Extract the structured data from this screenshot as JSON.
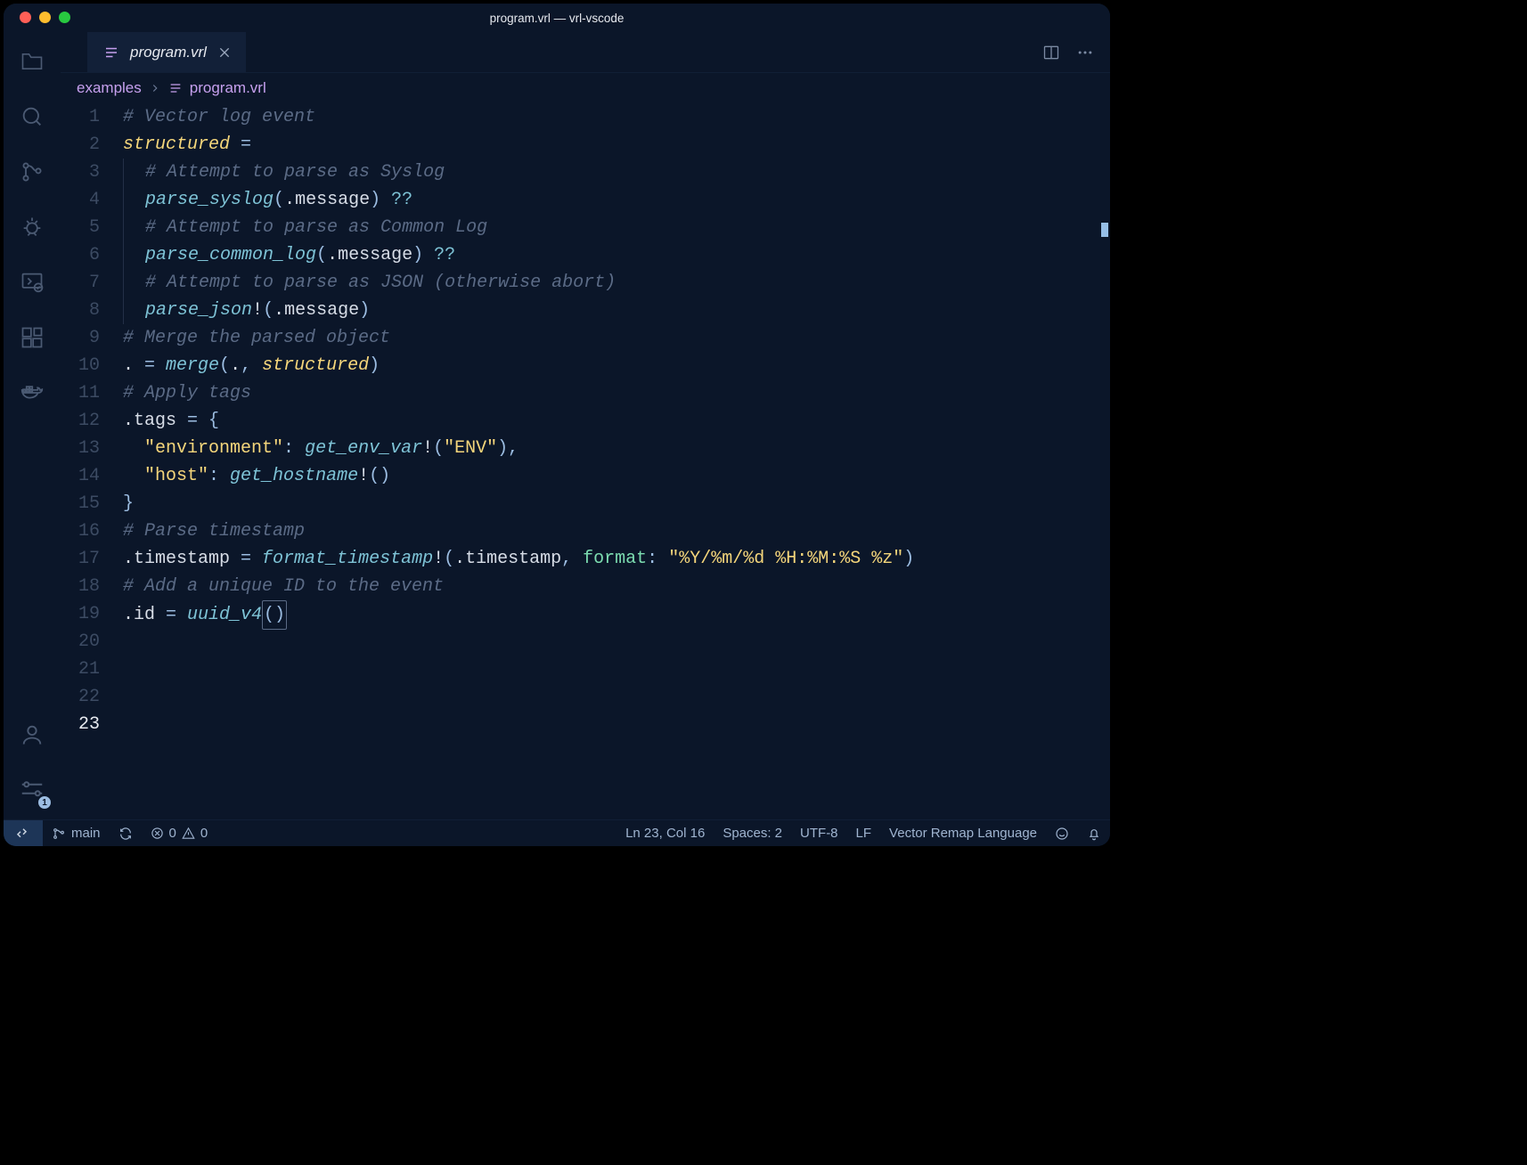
{
  "window": {
    "title": "program.vrl — vrl-vscode"
  },
  "tab": {
    "label": "program.vrl"
  },
  "breadcrumbs": {
    "folder": "examples",
    "file": "program.vrl"
  },
  "settings_badge": "1",
  "statusbar": {
    "branch": "main",
    "errors": "0",
    "warnings": "0",
    "position": "Ln 23, Col 16",
    "spaces": "Spaces: 2",
    "encoding": "UTF-8",
    "eol": "LF",
    "language": "Vector Remap Language"
  },
  "code": {
    "lines": [
      {
        "n": 1,
        "t": [
          [
            "comment",
            "# Vector log event"
          ]
        ]
      },
      {
        "n": 2,
        "t": [
          [
            "var",
            "structured"
          ],
          [
            "plain",
            " "
          ],
          [
            "op",
            "="
          ]
        ]
      },
      {
        "n": 3,
        "t": [
          [
            "indentguide",
            ""
          ],
          [
            "plain",
            "  "
          ],
          [
            "comment",
            "# Attempt to parse as Syslog"
          ]
        ]
      },
      {
        "n": 4,
        "t": [
          [
            "indentguide",
            ""
          ],
          [
            "plain",
            "  "
          ],
          [
            "fn",
            "parse_syslog"
          ],
          [
            "punc",
            "("
          ],
          [
            "field",
            ".message"
          ],
          [
            "punc",
            ")"
          ],
          [
            "plain",
            " "
          ],
          [
            "qq",
            "??"
          ]
        ]
      },
      {
        "n": 5,
        "t": [
          [
            "indentguide",
            ""
          ],
          [
            "plain",
            "  "
          ],
          [
            "comment",
            "# Attempt to parse as Common Log"
          ]
        ]
      },
      {
        "n": 6,
        "t": [
          [
            "indentguide",
            ""
          ],
          [
            "plain",
            "  "
          ],
          [
            "fn",
            "parse_common_log"
          ],
          [
            "punc",
            "("
          ],
          [
            "field",
            ".message"
          ],
          [
            "punc",
            ")"
          ],
          [
            "plain",
            " "
          ],
          [
            "qq",
            "??"
          ]
        ]
      },
      {
        "n": 7,
        "t": [
          [
            "indentguide",
            ""
          ],
          [
            "plain",
            "  "
          ],
          [
            "comment",
            "# Attempt to parse as JSON (otherwise abort)"
          ]
        ]
      },
      {
        "n": 8,
        "t": [
          [
            "indentguide",
            ""
          ],
          [
            "plain",
            "  "
          ],
          [
            "fn",
            "parse_json"
          ],
          [
            "bang",
            "!"
          ],
          [
            "punc",
            "("
          ],
          [
            "field",
            ".message"
          ],
          [
            "punc",
            ")"
          ]
        ]
      },
      {
        "n": 9,
        "t": [
          [
            "plain",
            ""
          ]
        ]
      },
      {
        "n": 10,
        "t": [
          [
            "comment",
            "# Merge the parsed object"
          ]
        ]
      },
      {
        "n": 11,
        "t": [
          [
            "field",
            ". "
          ],
          [
            "op",
            "= "
          ],
          [
            "fn",
            "merge"
          ],
          [
            "punc",
            "("
          ],
          [
            "field",
            "."
          ],
          [
            "punc",
            ", "
          ],
          [
            "var",
            "structured"
          ],
          [
            "punc",
            ")"
          ]
        ]
      },
      {
        "n": 12,
        "t": [
          [
            "plain",
            ""
          ]
        ]
      },
      {
        "n": 13,
        "t": [
          [
            "comment",
            "# Apply tags"
          ]
        ]
      },
      {
        "n": 14,
        "t": [
          [
            "field",
            ".tags "
          ],
          [
            "op",
            "= "
          ],
          [
            "punc",
            "{"
          ]
        ]
      },
      {
        "n": 15,
        "t": [
          [
            "plain",
            "  "
          ],
          [
            "str",
            "\"environment\""
          ],
          [
            "punc",
            ": "
          ],
          [
            "fn",
            "get_env_var"
          ],
          [
            "bang",
            "!"
          ],
          [
            "punc",
            "("
          ],
          [
            "str",
            "\"ENV\""
          ],
          [
            "punc",
            ")"
          ],
          [
            "punc",
            ","
          ]
        ]
      },
      {
        "n": 16,
        "t": [
          [
            "plain",
            "  "
          ],
          [
            "str",
            "\"host\""
          ],
          [
            "punc",
            ": "
          ],
          [
            "fn",
            "get_hostname"
          ],
          [
            "bang",
            "!"
          ],
          [
            "punc",
            "()"
          ]
        ]
      },
      {
        "n": 17,
        "t": [
          [
            "punc",
            "}"
          ]
        ]
      },
      {
        "n": 18,
        "t": [
          [
            "plain",
            ""
          ]
        ]
      },
      {
        "n": 19,
        "t": [
          [
            "comment",
            "# Parse timestamp"
          ]
        ]
      },
      {
        "n": 20,
        "t": [
          [
            "field",
            ".timestamp "
          ],
          [
            "op",
            "= "
          ],
          [
            "fn",
            "format_timestamp"
          ],
          [
            "bang",
            "!"
          ],
          [
            "punc",
            "("
          ],
          [
            "field",
            ".timestamp"
          ],
          [
            "punc",
            ", "
          ],
          [
            "argname",
            "format"
          ],
          [
            "punc",
            ": "
          ],
          [
            "str",
            "\"%Y/%m/%d %H:%M:%S %z\""
          ],
          [
            "punc",
            ")"
          ]
        ]
      },
      {
        "n": 21,
        "t": [
          [
            "plain",
            ""
          ]
        ]
      },
      {
        "n": 22,
        "t": [
          [
            "comment",
            "# Add a unique ID to the event"
          ]
        ]
      },
      {
        "n": 23,
        "t": [
          [
            "field",
            ".id "
          ],
          [
            "op",
            "= "
          ],
          [
            "fn",
            "uuid_v4"
          ],
          [
            "cursorparen",
            "()"
          ]
        ],
        "current": true
      }
    ]
  }
}
